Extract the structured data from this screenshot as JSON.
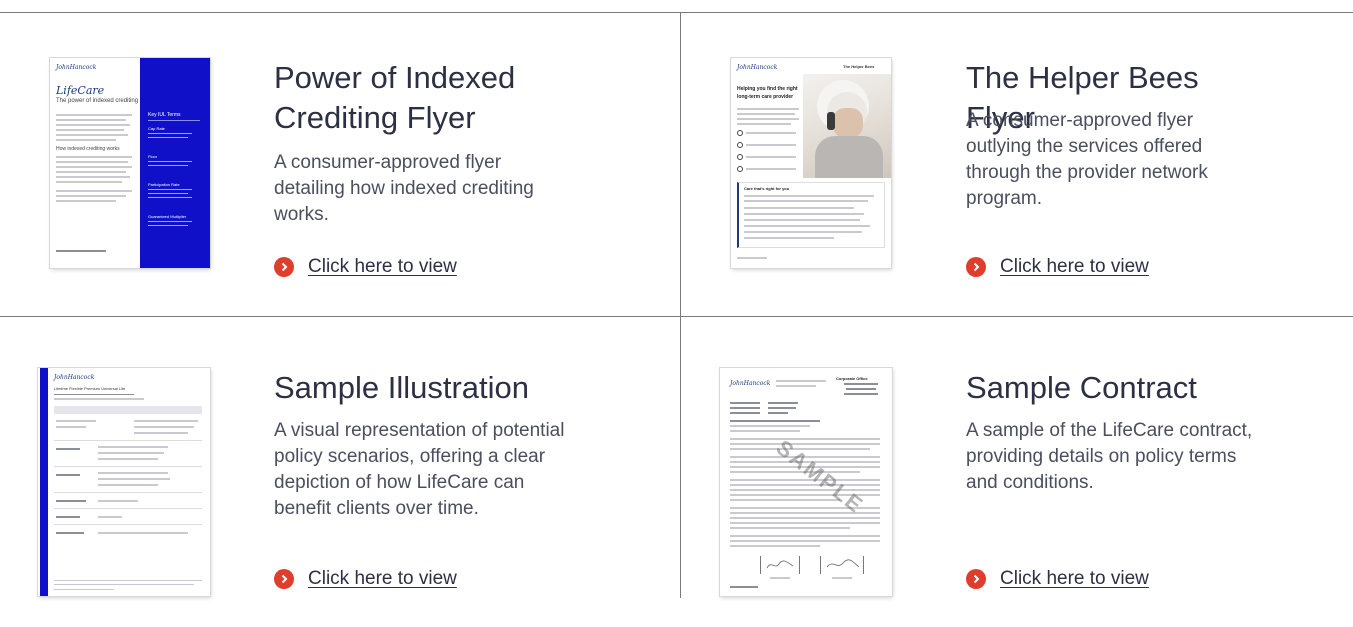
{
  "cards": [
    {
      "title": "Power of Indexed Crediting Flyer",
      "description": "A consumer-approved flyer detailing how indexed crediting works.",
      "link_label": "Click here to view",
      "thumbnail": {
        "brand": "JohnHancock",
        "heading": "LifeCare",
        "subheading": "The power of indexed crediting",
        "section": "How indexed crediting works",
        "sidebar_title": "Key IUL Terms",
        "sidebar_terms": [
          "Cap Rate",
          "Floor",
          "Participation Rate",
          "Guaranteed Multiplier"
        ]
      }
    },
    {
      "title": "The Helper Bees Flyer",
      "description": "A consumer-approved flyer outlying the services offered through the provider network program.",
      "link_label": "Click here to view",
      "thumbnail": {
        "brand": "JohnHancock",
        "partner": "The Helper Bees",
        "heading_line1": "Helping you find the right",
        "heading_line2": "long-term care provider",
        "box_title": "Care that's right for you"
      }
    },
    {
      "title": "Sample Illustration",
      "description": "A visual representation of potential policy scenarios, offering a clear depiction of how LifeCare can benefit clients over time.",
      "link_label": "Click here to view",
      "thumbnail": {
        "brand": "JohnHancock",
        "header_line": "Lifetime Flexible Premium Universal Life"
      }
    },
    {
      "title": "Sample Contract",
      "description": "A sample of the LifeCare contract, providing details on policy terms and conditions.",
      "link_label": "Click here to view",
      "thumbnail": {
        "brand": "JohnHancock",
        "watermark": "SAMPLE",
        "office_label": "Corporate Office"
      }
    }
  ],
  "colors": {
    "accent": "#e03e2d",
    "sidebar_blue": "#1010c8",
    "text_dark": "#2c3043",
    "rule": "#7a7a7a"
  },
  "icons": {
    "link_arrow": "chevron-right-circle-icon"
  }
}
